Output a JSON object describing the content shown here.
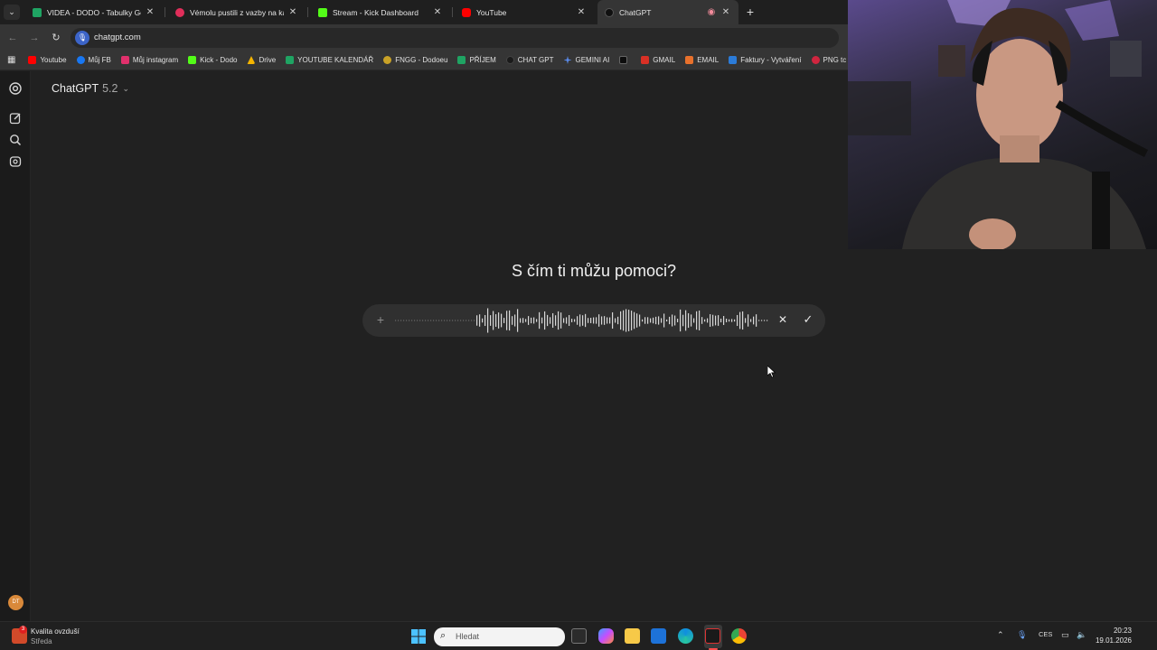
{
  "browser": {
    "tabs": [
      {
        "title": "VIDEA - DODO - Tabulky Googl",
        "color": "#1fa463"
      },
      {
        "title": "Vémolu pustili z vazby na kauc",
        "color": "#e02e5a"
      },
      {
        "title": "Stream - Kick Dashboard",
        "color": "#53fc18"
      },
      {
        "title": "YouTube",
        "color": "#ff0000"
      },
      {
        "title": "ChatGPT",
        "color": "#101010"
      }
    ],
    "url": "chatgpt.com",
    "bookmarks": [
      {
        "label": "Youtube",
        "color": "#ff0000"
      },
      {
        "label": "Můj FB",
        "color": "#1877f2"
      },
      {
        "label": "Můj instagram",
        "color": "#e1306c"
      },
      {
        "label": "Kick - Dodo",
        "color": "#53fc18"
      },
      {
        "label": "Drive",
        "color": "#f4b400"
      },
      {
        "label": "YOUTUBE KALENDÁŘ",
        "color": "#1fa463"
      },
      {
        "label": "FNGG - Dodoeu",
        "color": "#c9a227"
      },
      {
        "label": "PŘÍJEM",
        "color": "#1fa463"
      },
      {
        "label": "CHAT GPT",
        "color": "#1a1a1a"
      },
      {
        "label": "GEMINI AI",
        "color": "#5b8def"
      },
      {
        "label": "",
        "color": "#0d0d0d"
      },
      {
        "label": "GMAIL",
        "color": "#d93025"
      },
      {
        "label": "EMAIL",
        "color": "#e8712c"
      },
      {
        "label": "Faktury - Vytváření",
        "color": "#2b7bd8"
      },
      {
        "label": "PNG tc",
        "color": "#d0253f"
      }
    ]
  },
  "app": {
    "model_name": "ChatGPT",
    "model_version": "5.2",
    "heading": "S čím ti můžu pomoci?"
  },
  "taskbar": {
    "weather_title": "Kvalita ovzduší",
    "weather_sub": "Středa",
    "weather_badge": "3",
    "search_placeholder": "Hledat",
    "lang": "CES",
    "time": "20:23",
    "date": "19.01.2026"
  }
}
